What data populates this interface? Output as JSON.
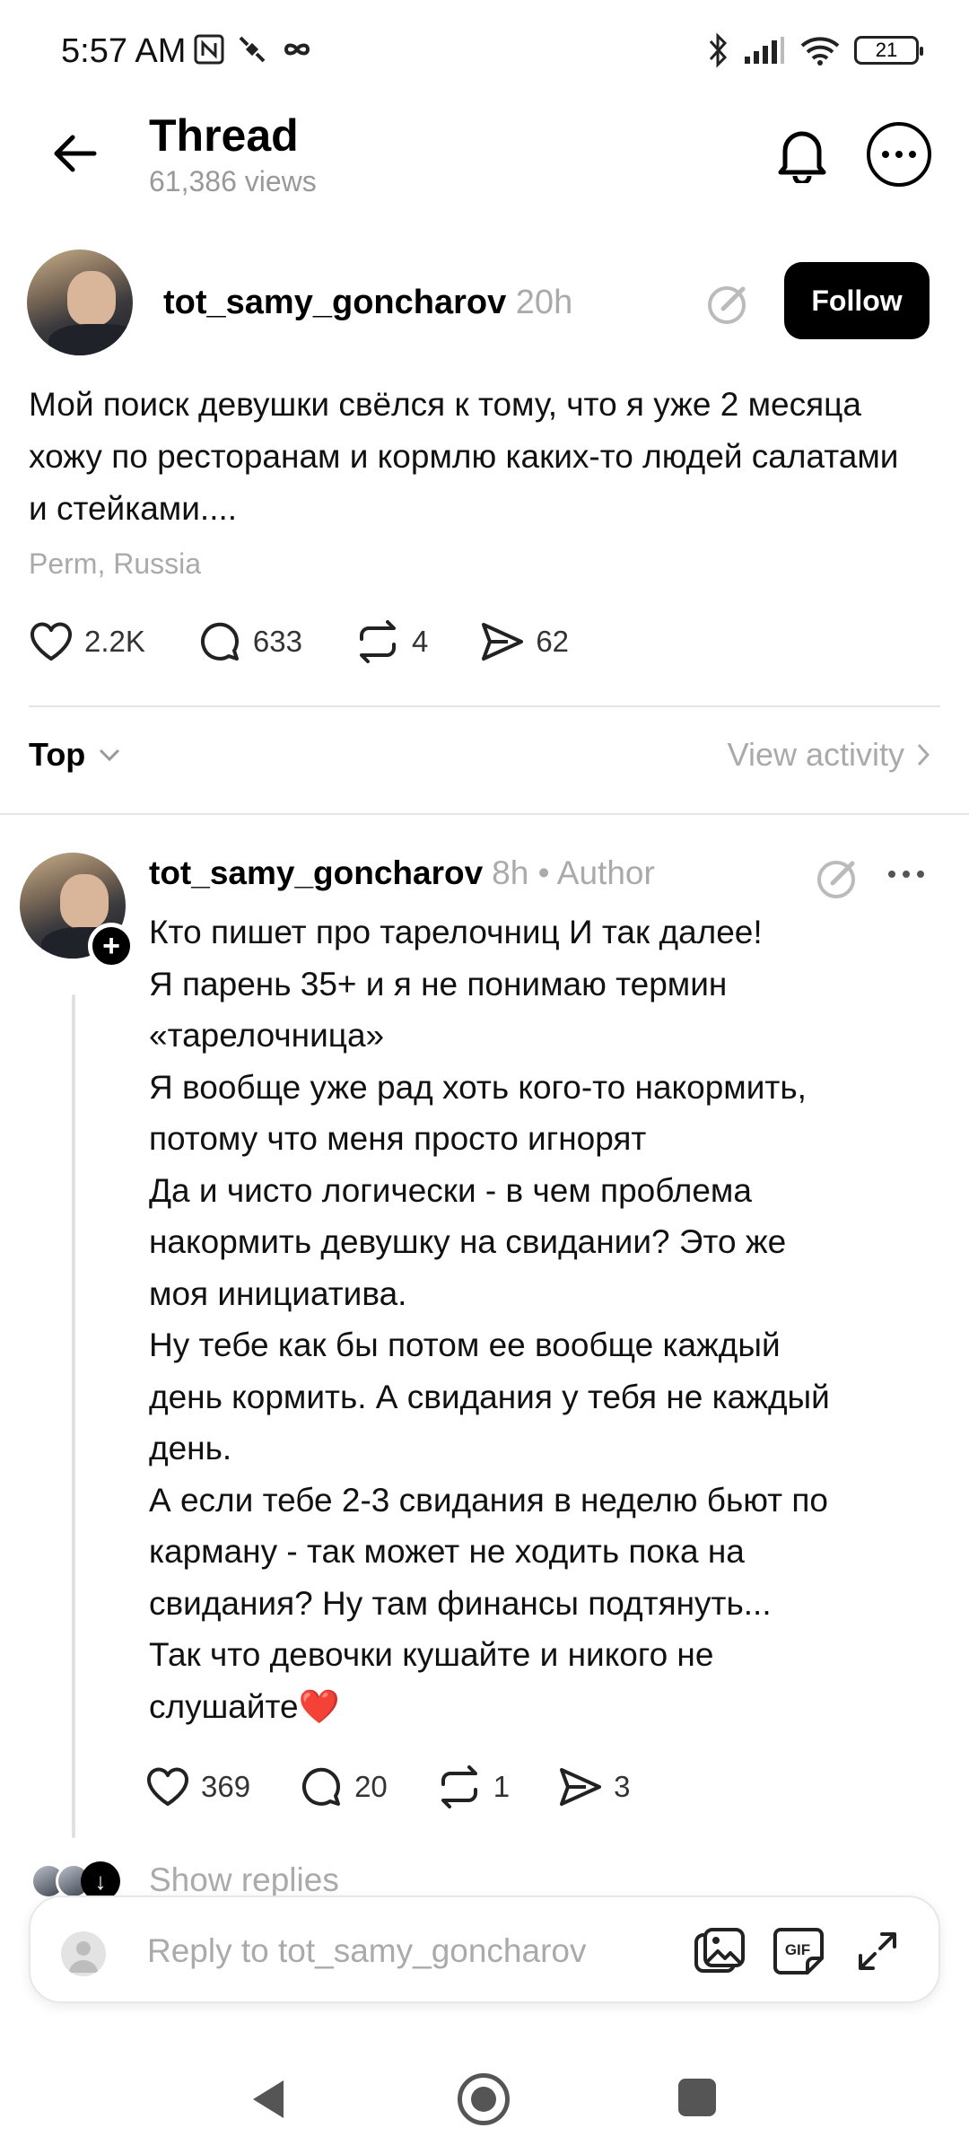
{
  "status_bar": {
    "time": "5:57 AM",
    "battery": "21",
    "icons": [
      "nfc-icon",
      "satellite-icon",
      "infinity-icon",
      "bluetooth-icon",
      "signal-icon",
      "wifi-icon",
      "battery-icon"
    ]
  },
  "header": {
    "title": "Thread",
    "views": "61,386 views"
  },
  "post": {
    "username": "tot_samy_goncharov",
    "time": "20h",
    "follow_label": "Follow",
    "text": "Мой поиск девушки свёлся к тому, что я уже 2 месяца хожу по ресторанам и кормлю каких-то людей салатами и стейками....",
    "location": "Perm, Russia",
    "likes": "2.2K",
    "comments": "633",
    "reposts": "4",
    "shares": "62"
  },
  "sort": {
    "label": "Top",
    "view_activity": "View activity"
  },
  "reply": {
    "username": "tot_samy_goncharov",
    "meta": "8h • Author",
    "lines": [
      "Кто пишет про тарелочниц И так далее!",
      "Я парень 35+ и я не понимаю термин",
      "«тарелочница»",
      "Я вообще уже рад хоть кого-то накормить,",
      "потому что меня просто игнорят",
      "Да и чисто логически - в чем проблема",
      "накормить девушку на свидании? Это же",
      "моя инициатива.",
      "Ну тебе как бы потом ее вообще каждый",
      "день кормить. А свидания у тебя не каждый",
      "день.",
      "А если тебе 2-3 свидания в неделю бьют по",
      "карману - так может не ходить пока на",
      "свидания? Ну там финансы подтянуть...",
      "Так что девочки кушайте и никого не",
      "слушайте❤️"
    ],
    "likes": "369",
    "comments": "20",
    "reposts": "1",
    "shares": "3"
  },
  "show_replies": "Show replies",
  "composer": {
    "placeholder": "Reply to tot_samy_goncharov",
    "gif_label": "GIF"
  },
  "colors": {
    "text": "#000000",
    "muted": "#aaaaaa",
    "divider": "#e6e6e6",
    "heart": "#e0222f"
  }
}
